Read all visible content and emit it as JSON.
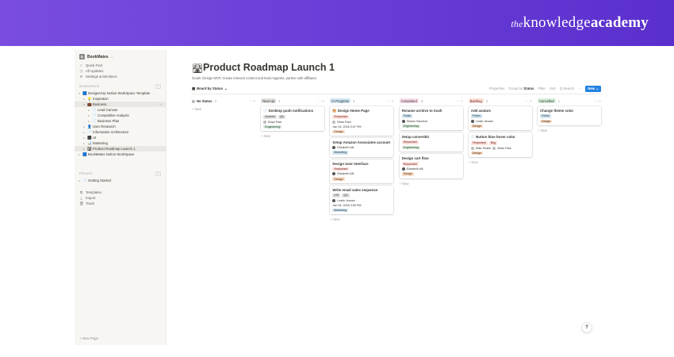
{
  "brand": {
    "prefix": "the",
    "word1": "knowledge",
    "word2": "academy"
  },
  "sidebar": {
    "workspace_badge": "B",
    "workspace_name": "BookMates",
    "top_items": [
      {
        "icon": "search-icon",
        "glyph": "⌕",
        "label": "Quick Find"
      },
      {
        "icon": "clock-icon",
        "glyph": "◷",
        "label": "All Updates"
      },
      {
        "icon": "gear-icon",
        "glyph": "⚙",
        "label": "Settings & Members"
      }
    ],
    "workspace_section": "WORKSPACE",
    "private_section": "PRIVATE",
    "tree": [
      {
        "indent": 0,
        "tri": "▾",
        "icon": "🟦",
        "label": "DesignerUp Notion WorkSpace Template",
        "active": false,
        "tail": ""
      },
      {
        "indent": 1,
        "tri": "▸",
        "icon": "💡",
        "label": "Inspiration",
        "active": false,
        "tail": ""
      },
      {
        "indent": 1,
        "tri": "▾",
        "icon": "💼",
        "label": "Business",
        "active": true,
        "tail": "··· +"
      },
      {
        "indent": 2,
        "tri": "▸",
        "icon": "📄",
        "label": "Lead Canvas",
        "active": false,
        "tail": ""
      },
      {
        "indent": 2,
        "tri": "▸",
        "icon": "📄",
        "label": "Competitive Analysis",
        "active": false,
        "tail": ""
      },
      {
        "indent": 2,
        "tri": "▸",
        "icon": "📄",
        "label": "Business Plan",
        "active": false,
        "tail": ""
      },
      {
        "indent": 1,
        "tri": "▸",
        "icon": "👤",
        "label": "User Research",
        "active": false,
        "tail": ""
      },
      {
        "indent": 1,
        "tri": "▸",
        "icon": "📄",
        "label": "Information Architecture",
        "active": false,
        "tail": ""
      },
      {
        "indent": 1,
        "tri": "▸",
        "icon": "⬛",
        "label": "UI",
        "active": false,
        "tail": ""
      },
      {
        "indent": 1,
        "tri": "▸",
        "icon": "📊",
        "label": "Marketing",
        "active": false,
        "tail": ""
      },
      {
        "indent": 1,
        "tri": "▸",
        "icon": "🛣",
        "label": "Product Roadmap Launch 1",
        "active": true,
        "tail": ""
      },
      {
        "indent": 0,
        "tri": "▸",
        "icon": "🟦",
        "label": "BookMates Notion WorkSpace",
        "active": false,
        "tail": ""
      }
    ],
    "private_tree": [
      {
        "indent": 0,
        "tri": "▸",
        "icon": "📄",
        "label": "Getting Started",
        "active": false,
        "tail": ""
      }
    ],
    "bottom_items": [
      {
        "icon": "templates-icon",
        "glyph": "⧉",
        "label": "Templates"
      },
      {
        "icon": "import-icon",
        "glyph": "⤓",
        "label": "Import"
      },
      {
        "icon": "trash-icon",
        "glyph": "🗑",
        "label": "Trash"
      }
    ],
    "new_page": "+ New Page"
  },
  "page": {
    "emoji": "🛣",
    "title": "Product Roadmap Launch 1",
    "description": "Goals: Design MVP, Create relevant content and lead magnets, partner with affiliates"
  },
  "toolbar": {
    "view_icon": "▦",
    "view_name": "Board by Status",
    "view_caret": "⌄",
    "properties": "Properties",
    "group_by": "Group by",
    "group_by_value": "Status",
    "filter": "Filter",
    "sort": "Sort",
    "search": "Q Search",
    "more": "···",
    "new": "New",
    "new_caret": "⌄"
  },
  "help": "?",
  "columns": [
    {
      "name": "No Status",
      "color": "none",
      "count": "0",
      "acts": "··· +",
      "new": "+ New",
      "cards": []
    },
    {
      "name": "Next Up",
      "color": "c-gray",
      "count": "1",
      "acts": "··· +",
      "new": "+ New",
      "cards": [
        {
          "icon": "📄",
          "title": "Desktop push notifications",
          "tags": [
            {
              "t": "Android",
              "c": "c-gray"
            },
            {
              "t": "QA",
              "c": "c-gray"
            }
          ],
          "people": [
            {
              "n": "Brian Park",
              "light": true
            }
          ],
          "date": "",
          "tags2": [
            {
              "t": "Engineering",
              "c": "c-green"
            }
          ]
        }
      ]
    },
    {
      "name": "In Progress",
      "color": "c-blue",
      "count": "4",
      "acts": "··· +",
      "new": "+ New",
      "cards": [
        {
          "icon": "🎨",
          "title": "Design Home Page",
          "tags": [
            {
              "t": "‼Important",
              "c": "c-red"
            }
          ],
          "people": [
            {
              "n": "Brian Park",
              "light": true
            }
          ],
          "date": "Jan 03, 2018 3:07 PM",
          "tags2": [
            {
              "t": "Design",
              "c": "c-orange"
            }
          ]
        },
        {
          "icon": "",
          "title": "Setup Amazon Associates account",
          "tags": [],
          "people": [
            {
              "n": "Elizabeth Alli",
              "light": false
            }
          ],
          "date": "",
          "tags2": [
            {
              "t": "Marketing",
              "c": "c-blue"
            }
          ]
        },
        {
          "icon": "",
          "title": "Design User Interface",
          "tags": [
            {
              "t": "‼Important",
              "c": "c-red"
            }
          ],
          "people": [
            {
              "n": "Elizabeth Alli",
              "light": false
            }
          ],
          "date": "",
          "tags2": [
            {
              "t": "Design",
              "c": "c-orange"
            }
          ]
        },
        {
          "icon": "",
          "title": "Write email sales sequence",
          "tags": [
            {
              "t": "iOS",
              "c": "c-gray"
            },
            {
              "t": "QA",
              "c": "c-gray"
            }
          ],
          "people": [
            {
              "n": "Leslie Jensen",
              "light": false
            }
          ],
          "date": "Jan 06, 2018 3:50 PM",
          "tags2": [
            {
              "t": "Marketing",
              "c": "c-blue"
            }
          ]
        }
      ]
    },
    {
      "name": "Completed",
      "color": "c-pink",
      "count": "3",
      "acts": "··· +",
      "new": "+ New",
      "cards": [
        {
          "icon": "",
          "title": "Rename archive to trash",
          "tags": [
            {
              "t": "Polish",
              "c": "c-blue"
            }
          ],
          "people": [
            {
              "n": "Shawn Sanchez",
              "light": false
            }
          ],
          "date": "",
          "tags2": [
            {
              "t": "Engineering",
              "c": "c-green"
            }
          ]
        },
        {
          "icon": "",
          "title": "Setup convertkit",
          "tags": [
            {
              "t": "‼Important",
              "c": "c-red"
            }
          ],
          "people": [],
          "date": "",
          "tags2": [
            {
              "t": "Engineering",
              "c": "c-green"
            }
          ]
        },
        {
          "icon": "",
          "title": "Design cart flow",
          "tags": [
            {
              "t": "‼Important",
              "c": "c-red"
            }
          ],
          "people": [
            {
              "n": "Elizabeth Alli",
              "light": false
            }
          ],
          "date": "",
          "tags2": [
            {
              "t": "Design",
              "c": "c-orange"
            }
          ]
        }
      ]
    },
    {
      "name": "Backlog",
      "color": "c-red",
      "count": "2",
      "acts": "··· +",
      "new": "+ New",
      "cards": [
        {
          "icon": "",
          "title": "Add avatars",
          "tags": [
            {
              "t": "Polish",
              "c": "c-blue"
            }
          ],
          "people": [
            {
              "n": "Leslie Jensen",
              "light": false
            }
          ],
          "date": "",
          "tags2": [
            {
              "t": "Design",
              "c": "c-orange"
            }
          ]
        },
        {
          "icon": "📄",
          "title": "Button blue hover color",
          "tags": [
            {
              "t": "‼Important",
              "c": "c-red"
            },
            {
              "t": "Bug",
              "c": "c-red"
            }
          ],
          "people": [
            {
              "n": "Mike Shafer",
              "light": true
            },
            {
              "n": "Brian Park",
              "light": true
            }
          ],
          "date": "",
          "tags2": [
            {
              "t": "Design",
              "c": "c-orange"
            }
          ]
        }
      ]
    },
    {
      "name": "Cancelled",
      "color": "c-green",
      "count": "1",
      "acts": "··· +",
      "new": "+ New",
      "cards": [
        {
          "icon": "",
          "title": "Change theme color",
          "tags": [
            {
              "t": "Polish",
              "c": "c-blue"
            }
          ],
          "people": [],
          "date": "",
          "tags2": [
            {
              "t": "Design",
              "c": "c-orange"
            }
          ]
        }
      ]
    }
  ]
}
